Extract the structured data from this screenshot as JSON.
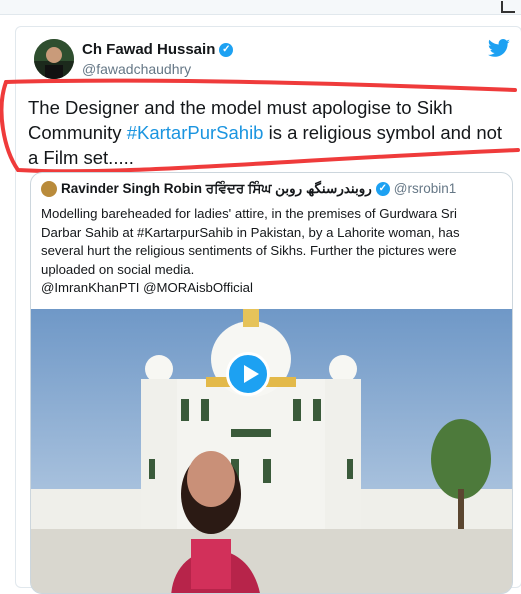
{
  "tweet": {
    "author_name": "Ch Fawad Hussain",
    "author_handle": "@fawadchaudhry",
    "text_before": "The Designer and the model must apologise to Sikh Community ",
    "hashtag": "#KartarPurSahib",
    "text_after": " is a religious symbol and not a Film set.....",
    "icons": {
      "verified": "verified-badge-icon",
      "brand": "twitter-bird-icon"
    }
  },
  "quoted_tweet": {
    "author_name": "Ravinder Singh Robin ਰਵਿੰਦਰ ਸਿੰਘ روبندرسنگھ روبن",
    "author_handle": "@rsrobin1",
    "body_lines": [
      "Modelling bareheaded for ladies' attire, in the premises  of Gurdwara Sri",
      "Darbar Sahib at #KartarpurSahib in Pakistan, by a Lahorite woman,  has",
      "several hurt the religious sentiments of Sikhs. Further the pictures were",
      "uploaded on social media.",
      "@ImranKhanPTI  @MORAisbOfficial"
    ]
  },
  "colors": {
    "accent": "#1da1f2",
    "hashtag": "#1b95e0",
    "highlight": "#ef3b3b"
  }
}
